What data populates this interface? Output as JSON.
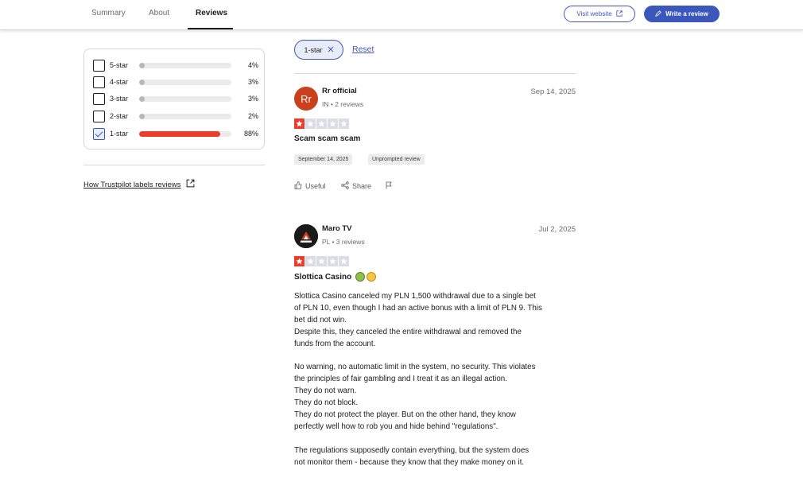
{
  "nav": {
    "tabs": [
      {
        "label": "Summary"
      },
      {
        "label": "About"
      },
      {
        "label": "Reviews",
        "active": true
      }
    ],
    "visit_website": "Visit website",
    "write_review": "Write a review"
  },
  "filters": {
    "rows": [
      {
        "label": "5-star",
        "pct": "4%",
        "value": 0.04,
        "checked": false
      },
      {
        "label": "4-star",
        "pct": "3%",
        "value": 0.03,
        "checked": false
      },
      {
        "label": "3-star",
        "pct": "3%",
        "value": 0.03,
        "checked": false
      },
      {
        "label": "2-star",
        "pct": "2%",
        "value": 0.02,
        "checked": false
      },
      {
        "label": "1-star",
        "pct": "88%",
        "value": 0.88,
        "checked": true
      }
    ],
    "how_link": "How Trustpilot labels reviews"
  },
  "active_filters": {
    "chip": "1-star",
    "reset": "Reset"
  },
  "reviews": [
    {
      "avatar_text": "Rr",
      "name": "Rr official",
      "meta": "IN • 2 reviews",
      "date": "Sep 14, 2025",
      "rating": 1,
      "title": "Scam scam scam",
      "tags": [
        "September 14, 2025",
        "Unprompted review"
      ],
      "useful": "Useful",
      "share": "Share"
    },
    {
      "avatar_text": "MAROTV",
      "name": "Maro TV",
      "meta": "PL • 3 reviews",
      "date": "Jul 2, 2025",
      "rating": 1,
      "title": "Slottica Casino",
      "body": [
        "Slottica Casino canceled my PLN 1,500 withdrawal due to a single bet",
        "of PLN 10, even though I had an active bonus with a limit of PLN 9. This",
        "bet did not win.",
        "Despite this, they canceled the entire withdrawal and removed the",
        "funds from the account.",
        "",
        "No warning, no automatic limit in the system, no security. This violates",
        "the principles of fair gambling and I treat it as an illegal action.",
        "They do not warn.",
        "They do not block.",
        "They do not protect the player. But on the other hand, they know",
        "perfectly well how to rob you and hide behind \"regulations\".",
        "",
        "The regulations supposedly contain everything, but the system does",
        "not monitor them - because they know that they make money on it."
      ]
    }
  ],
  "colors": {
    "accent": "#3c57bc",
    "star_red": "#ee3b2a",
    "avatar_rr": "#c9401d"
  }
}
